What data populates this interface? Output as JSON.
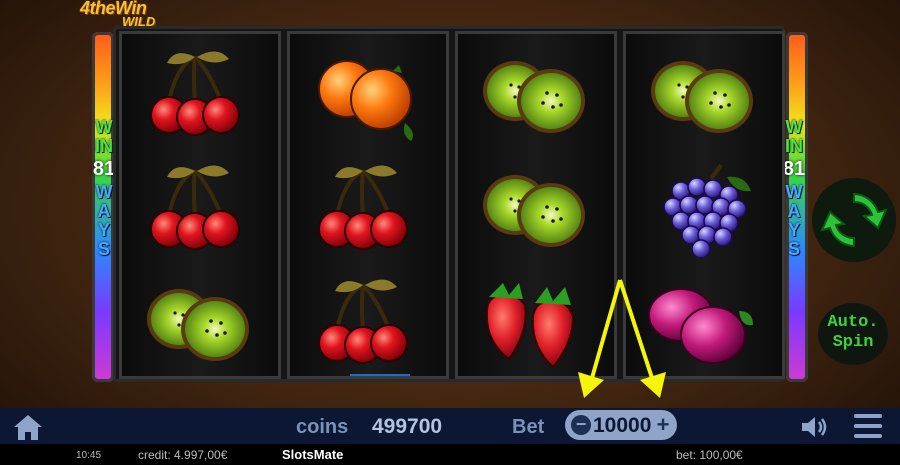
{
  "game": {
    "logo_line1": "4theWin",
    "logo_line2": "WILD"
  },
  "win_ways": {
    "word1": "WIN",
    "number": "81",
    "word2": "WAYS"
  },
  "reels": [
    [
      "cherries",
      "cherries",
      "kiwi"
    ],
    [
      "orange",
      "cherries",
      "cherries"
    ],
    [
      "kiwi",
      "kiwi",
      "strawberry"
    ],
    [
      "kiwi",
      "grapes",
      "plums"
    ]
  ],
  "controls": {
    "spin_icon": "refresh-icon",
    "auto_spin_line1": "Auto.",
    "auto_spin_line2": "Spin"
  },
  "bottom_bar": {
    "coins_label": "coins",
    "coins_value": "499700",
    "bet_label": "Bet",
    "bet_minus": "−",
    "bet_value": "10000",
    "bet_plus": "+"
  },
  "status_bar": {
    "time": "10:45",
    "credit": "credit: 4.997,00€",
    "brand": "SlotsMate",
    "bet": "bet: 100,00€"
  },
  "colors": {
    "win_green": "#4ce44c",
    "ways_blue": "#4aa8ff",
    "bar_bg": "#0c1734",
    "annotation_yellow": "#f5f50a"
  }
}
